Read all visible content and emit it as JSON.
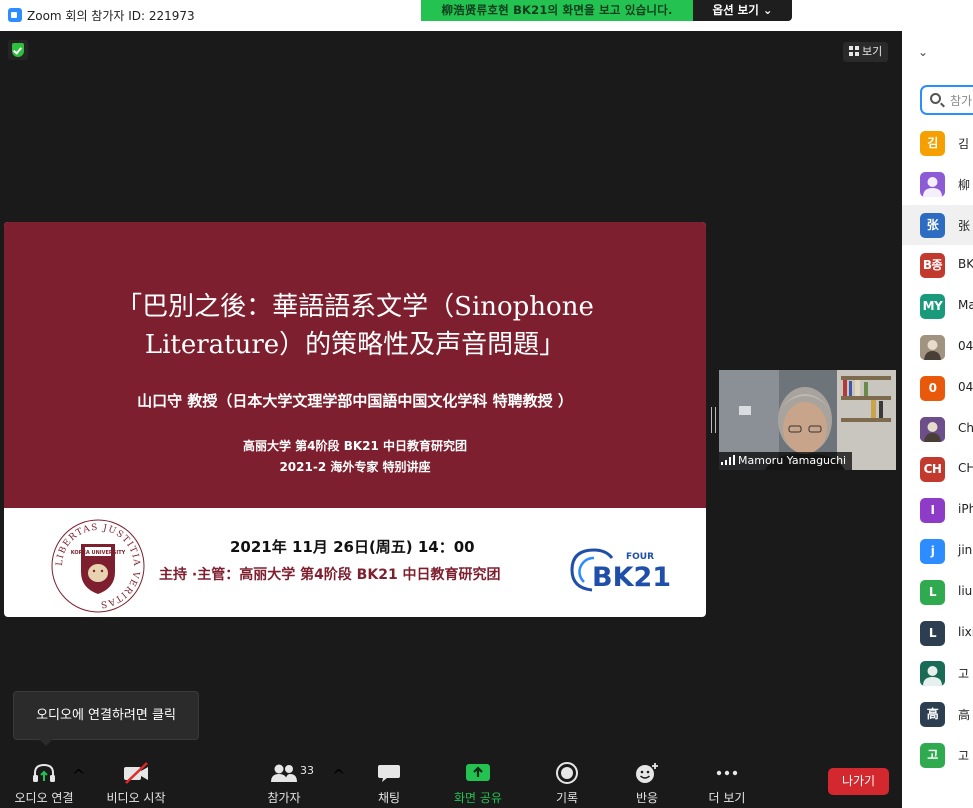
{
  "window": {
    "title": "Zoom 회의 참가자 ID: 221973"
  },
  "share_banner": {
    "text": "柳浩贤류호현 BK21의 화면을 보고 있습니다.",
    "options_label": "옵션 보기",
    "color": "#23c251"
  },
  "view_button": {
    "label": "보기"
  },
  "slide": {
    "title_line1": "「巴別之後：華語語系文学（Sinophone",
    "title_line2": "Literature）的策略性及声音問題」",
    "author": "山口守 教授（日本大学文理学部中国語中国文化学科 特聘教授 ）",
    "org_line1": "高丽大学 第4阶段 BK21 中日教育研究团",
    "org_line2": "2021-2 海外专家 特别讲座",
    "date": "2021年 11月 26日(周五) 14：00",
    "host": "主持 ·主管：高丽大学 第4阶段 BK21 中日教育研究团",
    "seal_text": "LIBERTAS JUSTITIA VERITAS",
    "seal_inner": "KOREA UNIVERSITY",
    "bk_logo": {
      "four": "FOUR",
      "name": "BK21"
    },
    "accent_color": "#7d1f2e"
  },
  "video_tile": {
    "name": "Mamoru Yamaguchi"
  },
  "tooltip": {
    "text": "오디오에 연결하려면 클릭"
  },
  "toolbar": {
    "audio": "오디오 연결",
    "video": "비디오 시작",
    "participants": "참가자",
    "participants_count": "33",
    "chat": "채팅",
    "share": "화면 공유",
    "record": "기록",
    "reactions": "반응",
    "more": "더 보기",
    "leave": "나가기"
  },
  "panel": {
    "search_placeholder": "참가",
    "participants": [
      {
        "initial": "김",
        "name": "김",
        "color": "#f59f00",
        "icon": "initial"
      },
      {
        "initial": "",
        "name": "柳",
        "color": "#8e5bd6",
        "icon": "person-icon"
      },
      {
        "initial": "张",
        "name": "张",
        "color": "#2d6cc0",
        "icon": "initial",
        "selected": true
      },
      {
        "initial": "B종",
        "name": "BK",
        "color": "#c23a2e",
        "icon": "initial"
      },
      {
        "initial": "MY",
        "name": "Ma",
        "color": "#1a9a7a",
        "icon": "initial"
      },
      {
        "initial": "",
        "name": "04",
        "color": "#a0937f",
        "icon": "photo-icon"
      },
      {
        "initial": "0",
        "name": "04",
        "color": "#e8590c",
        "icon": "initial"
      },
      {
        "initial": "",
        "name": "Ch",
        "color": "#6b4e8a",
        "icon": "photo-icon"
      },
      {
        "initial": "CH",
        "name": "CH",
        "color": "#c23a2e",
        "icon": "initial"
      },
      {
        "initial": "I",
        "name": "iPh",
        "color": "#8e3cc8",
        "icon": "initial"
      },
      {
        "initial": "j",
        "name": "jin",
        "color": "#2d8cff",
        "icon": "initial"
      },
      {
        "initial": "L",
        "name": "liu",
        "color": "#2faa4f",
        "icon": "initial"
      },
      {
        "initial": "L",
        "name": "lixi",
        "color": "#2c3e50",
        "icon": "initial"
      },
      {
        "initial": "",
        "name": "고",
        "color": "#1a6b55",
        "icon": "person-icon"
      },
      {
        "initial": "高",
        "name": "高",
        "color": "#2c3e50",
        "icon": "initial"
      },
      {
        "initial": "고",
        "name": "고",
        "color": "#2faa4f",
        "icon": "initial"
      }
    ]
  }
}
